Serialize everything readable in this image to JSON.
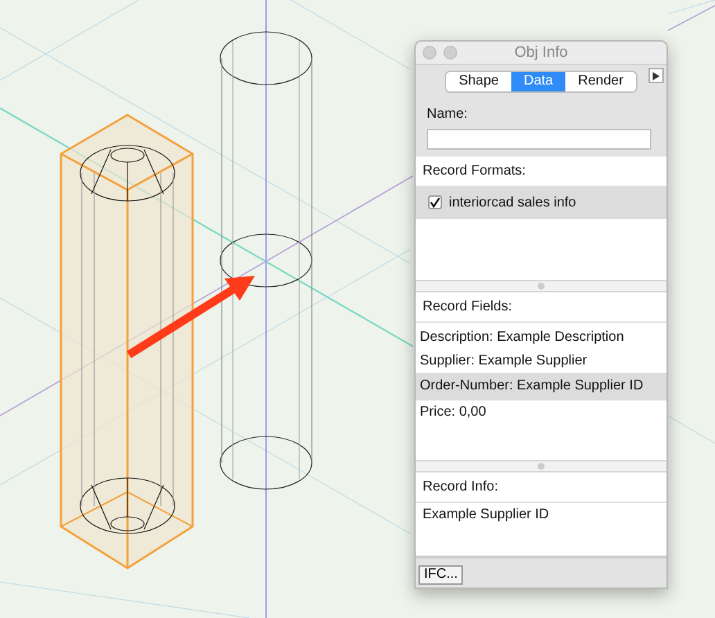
{
  "window": {
    "title": "Obj Info"
  },
  "tabs": [
    {
      "label": "Shape",
      "selected": false
    },
    {
      "label": "Data",
      "selected": true
    },
    {
      "label": "Render",
      "selected": false
    }
  ],
  "name": {
    "label": "Name:"
  },
  "record_formats": {
    "header": "Record Formats:",
    "items": [
      {
        "label": "interiorcad sales info",
        "checked": true,
        "selected": true
      }
    ]
  },
  "record_fields": {
    "header": "Record Fields:",
    "items": [
      {
        "text": "Description: Example Description",
        "selected": false
      },
      {
        "text": "Supplier: Example Supplier",
        "selected": false
      },
      {
        "text": "Order-Number: Example Supplier ID",
        "selected": true
      },
      {
        "text": "Price: 0,00",
        "selected": false
      }
    ]
  },
  "record_info": {
    "header": "Record Info:",
    "text": "Example Supplier ID"
  },
  "buttons": [
    "IFC..."
  ]
}
